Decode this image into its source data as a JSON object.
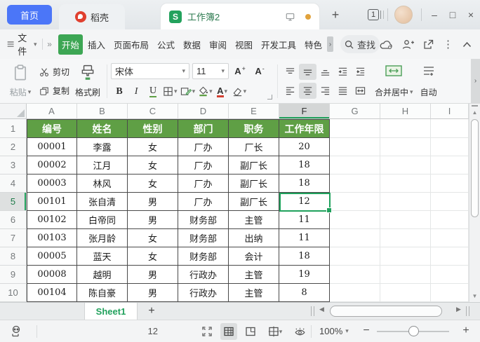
{
  "title_bar": {
    "home_tab": "首页",
    "docer_tab": "稻壳",
    "document_tab": "工作簿2",
    "window_badge": "1",
    "new_tab": "+",
    "minimize": "–",
    "maximize": "□",
    "close": "×"
  },
  "menu_bar": {
    "file_menu": "文件",
    "overflow": "»",
    "tabs": [
      "开始",
      "插入",
      "页面布局",
      "公式",
      "数据",
      "审阅",
      "视图",
      "开发工具",
      "特色"
    ],
    "active_tab": "开始",
    "more_tabs": "›",
    "search_label": "查找"
  },
  "ribbon": {
    "paste": "粘贴",
    "cut": "剪切",
    "copy": "复制",
    "format_painter": "格式刷",
    "font_name": "宋体",
    "font_size": "11",
    "bold": "B",
    "italic": "I",
    "underline": "U",
    "grow_font": "A",
    "grow_sign": "+",
    "shrink_font": "A",
    "shrink_sign": "-",
    "font_color_letter": "A",
    "merge_center": "合并居中",
    "auto_label": "自动",
    "scroll_more": "›"
  },
  "grid": {
    "column_headers": [
      "A",
      "B",
      "C",
      "D",
      "E",
      "F",
      "G",
      "H",
      "I"
    ],
    "selected_column": "F",
    "selected_row": "5",
    "table_header": [
      "编号",
      "姓名",
      "性别",
      "部门",
      "职务",
      "工作年限"
    ],
    "table_rows": [
      [
        "00001",
        "李露",
        "女",
        "厂办",
        "厂长",
        "20"
      ],
      [
        "00002",
        "江月",
        "女",
        "厂办",
        "副厂长",
        "18"
      ],
      [
        "00003",
        "林风",
        "女",
        "厂办",
        "副厂长",
        "18"
      ],
      [
        "00101",
        "张自清",
        "男",
        "厂办",
        "副厂长",
        "12"
      ],
      [
        "00102",
        "白帝同",
        "男",
        "财务部",
        "主管",
        "11"
      ],
      [
        "00103",
        "张月龄",
        "女",
        "财务部",
        "出纳",
        "11"
      ],
      [
        "00005",
        "蓝天",
        "女",
        "财务部",
        "会计",
        "18"
      ],
      [
        "00008",
        "越明",
        "男",
        "行政办",
        "主管",
        "19"
      ],
      [
        "00104",
        "陈自豪",
        "男",
        "行政办",
        "主管",
        "8"
      ]
    ]
  },
  "sheet_bar": {
    "sheet_tab": "Sheet1",
    "add_sheet": "+"
  },
  "status_bar": {
    "summary_value": "12",
    "zoom_level": "100%",
    "zoom_out": "−",
    "zoom_in": "+"
  },
  "colors": {
    "accent_green": "#3da654",
    "table_header_green": "#5f9f45",
    "selection_green": "#21a15c",
    "home_blue": "#4b76f8",
    "docer_red": "#e0402f",
    "unsaved_dot": "#e1a23c"
  }
}
